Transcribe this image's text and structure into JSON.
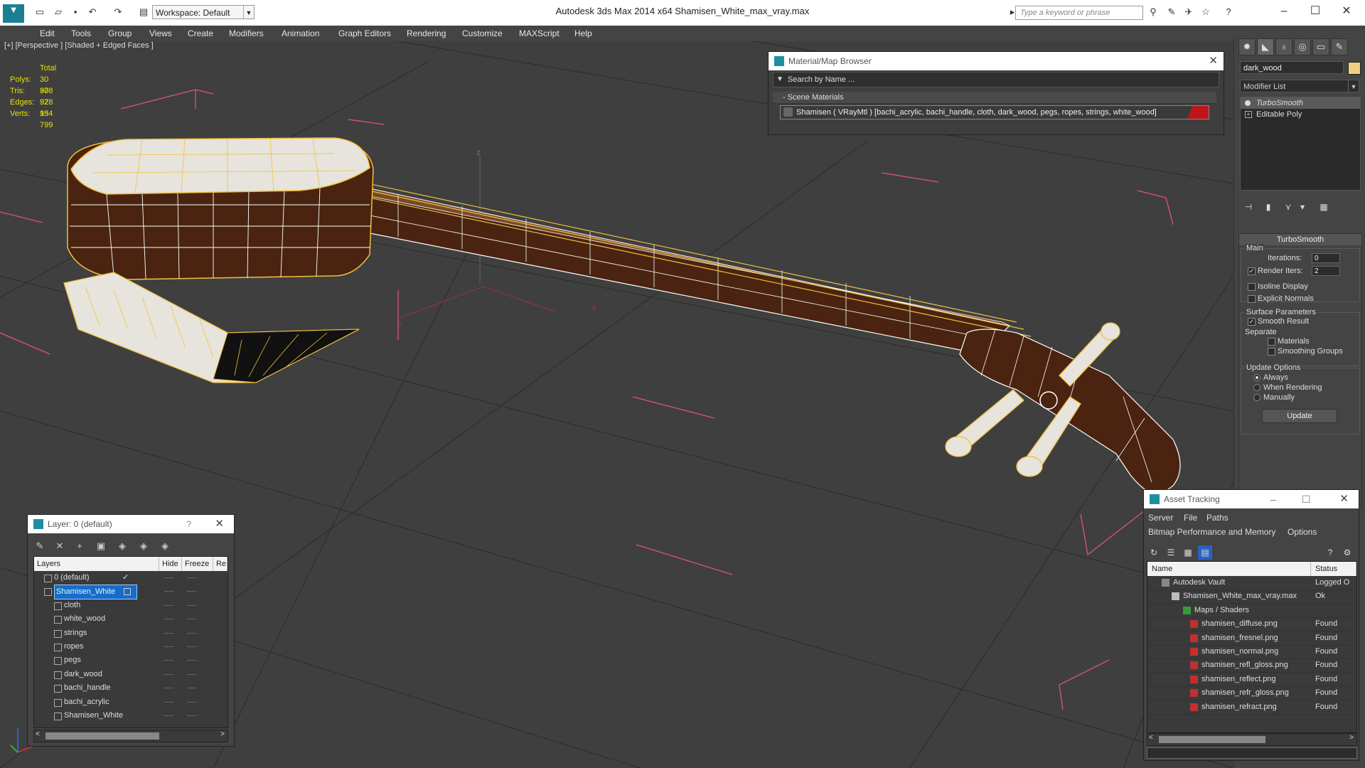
{
  "titlebar": {
    "title": "Autodesk 3ds Max  2014 x64     Shamisen_White_max_vray.max",
    "workspace": "Workspace: Default",
    "search_placeholder": "Type a keyword or phrase",
    "minimize": "–",
    "maximize": "☐",
    "close": "✕"
  },
  "menu": [
    "Edit",
    "Tools",
    "Group",
    "Views",
    "Create",
    "Modifiers",
    "Animation",
    "Graph Editors",
    "Rendering",
    "Customize",
    "MAXScript",
    "Help"
  ],
  "viewport": {
    "label": "[+] [Perspective ] [Shaded + Edged Faces ]",
    "stats": {
      "header": "Total",
      "rows": [
        {
          "k": "Polys:",
          "v": "30 978"
        },
        {
          "k": "Tris:",
          "v": "30 978"
        },
        {
          "k": "Edges:",
          "v": "92 934"
        },
        {
          "k": "Verts:",
          "v": "15 799"
        }
      ]
    },
    "axis_x": "x",
    "axis_y": "y",
    "axis_z": "z"
  },
  "material_browser": {
    "title": "Material/Map Browser",
    "search_placeholder": "Search by Name ...",
    "section": "- Scene Materials",
    "material": "Shamisen  ( VRayMtl ) [bachi_acrylic, bachi_handle, cloth, dark_wood, pegs, ropes, strings, white_wood]"
  },
  "command_panel": {
    "object_name": "dark_wood",
    "object_color": "#f0d080",
    "modifier_list": "Modifier List",
    "stack": [
      "TurboSmooth",
      "Editable Poly"
    ],
    "rollout_title": "TurboSmooth",
    "main": "Main",
    "iterations_label": "Iterations:",
    "iterations_value": "0",
    "render_iters_label": "Render Iters:",
    "render_iters_value": "2",
    "isoline": "Isoline Display",
    "explicit_normals": "Explicit Normals",
    "surface_params": "Surface Parameters",
    "smooth_result": "Smooth Result",
    "separate": "Separate",
    "materials": "Materials",
    "smoothing_groups": "Smoothing Groups",
    "update_options": "Update Options",
    "always": "Always",
    "when_rendering": "When Rendering",
    "manually": "Manually",
    "update_button": "Update"
  },
  "layer_panel": {
    "title": "Layer: 0 (default)",
    "help": "?",
    "close": "✕",
    "columns": [
      "Layers",
      "Hide",
      "Freeze",
      "Re"
    ],
    "rows": [
      {
        "name": "0 (default)",
        "level": 0
      },
      {
        "name": "Shamisen_White",
        "level": 0
      },
      {
        "name": "cloth",
        "level": 1
      },
      {
        "name": "white_wood",
        "level": 1
      },
      {
        "name": "strings",
        "level": 1
      },
      {
        "name": "ropes",
        "level": 1
      },
      {
        "name": "pegs",
        "level": 1
      },
      {
        "name": "dark_wood",
        "level": 1
      },
      {
        "name": "bachi_handle",
        "level": 1
      },
      {
        "name": "bachi_acrylic",
        "level": 1
      },
      {
        "name": "Shamisen_White",
        "level": 1
      }
    ]
  },
  "asset_tracking": {
    "title": "Asset Tracking",
    "menu": [
      "Server",
      "File",
      "Paths",
      "Bitmap Performance and Memory",
      "Options"
    ],
    "columns": [
      "Name",
      "Status"
    ],
    "rows": [
      {
        "name": "Autodesk Vault",
        "status": "Logged O"
      },
      {
        "name": "Shamisen_White_max_vray.max",
        "status": "Ok"
      },
      {
        "name": "Maps / Shaders",
        "status": ""
      },
      {
        "name": "shamisen_diffuse.png",
        "status": "Found"
      },
      {
        "name": "shamisen_fresnel.png",
        "status": "Found"
      },
      {
        "name": "shamisen_normal.png",
        "status": "Found"
      },
      {
        "name": "shamisen_refl_gloss.png",
        "status": "Found"
      },
      {
        "name": "shamisen_reflect.png",
        "status": "Found"
      },
      {
        "name": "shamisen_refr_gloss.png",
        "status": "Found"
      },
      {
        "name": "shamisen_refract.png",
        "status": "Found"
      }
    ]
  },
  "colors": {
    "wire_selected": "#f0c040",
    "wire_white": "#ffffff",
    "wood_dark": "#4a2410",
    "body_white": "#e6e4dc",
    "grid_line": "#2a2a2a",
    "bbox": "#e05080"
  }
}
